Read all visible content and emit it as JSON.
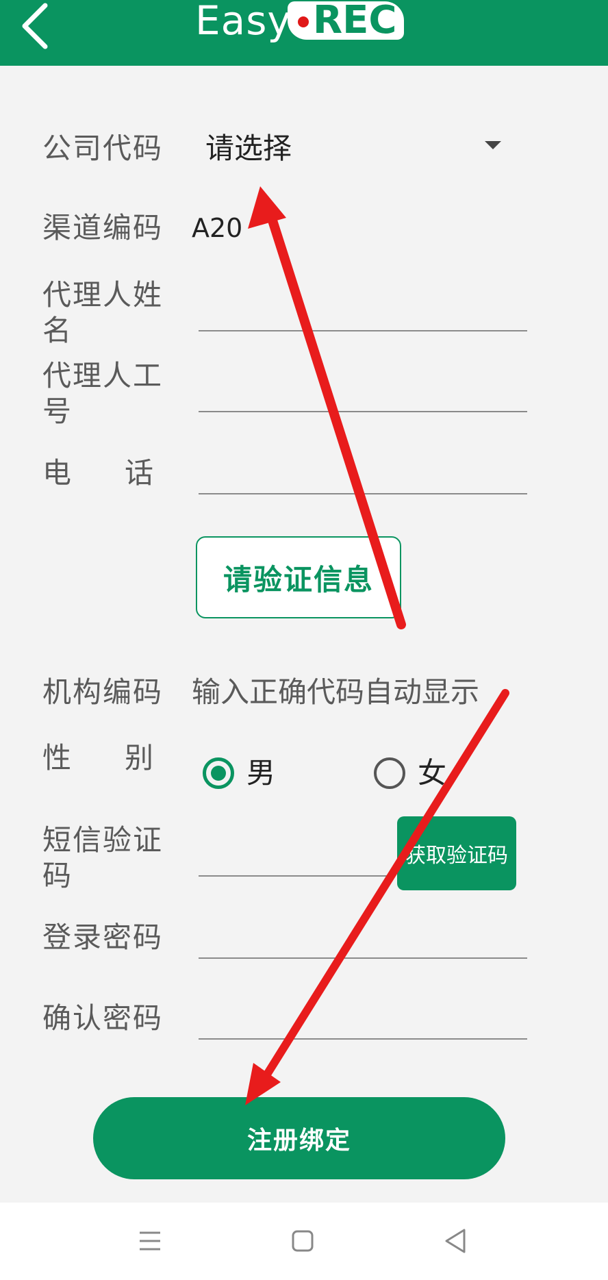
{
  "header": {
    "logo_easy": "Easy",
    "logo_rec": "REC",
    "back_icon": "chevron-left-icon"
  },
  "form": {
    "company_code": {
      "label": "公司代码",
      "value": "请选择"
    },
    "channel_code": {
      "label": "渠道编码",
      "value": "A20"
    },
    "agent_name": {
      "label_line1": "代理人姓",
      "label_line2": "名",
      "value": ""
    },
    "agent_id": {
      "label_line1": "代理人工",
      "label_line2": "号",
      "value": ""
    },
    "phone": {
      "label_char1": "电",
      "label_char2": "话",
      "value": ""
    },
    "verify_button": "请验证信息",
    "org_code": {
      "label": "机构编码",
      "value": "输入正确代码自动显示"
    },
    "gender": {
      "label_char1": "性",
      "label_char2": "别",
      "options": [
        "男",
        "女"
      ],
      "selected": "男"
    },
    "sms_code": {
      "label_line1": "短信验证",
      "label_line2": "码",
      "value": "",
      "button": "获取验证码"
    },
    "login_password": {
      "label": "登录密码",
      "value": ""
    },
    "confirm_password": {
      "label": "确认密码",
      "value": ""
    },
    "register_button": "注册绑定"
  },
  "colors": {
    "brand_green": "#0a9460",
    "annotation_red": "#e81c1c"
  },
  "nav_bar": {
    "icons": [
      "menu-icon",
      "home-square-icon",
      "back-triangle-icon"
    ]
  }
}
